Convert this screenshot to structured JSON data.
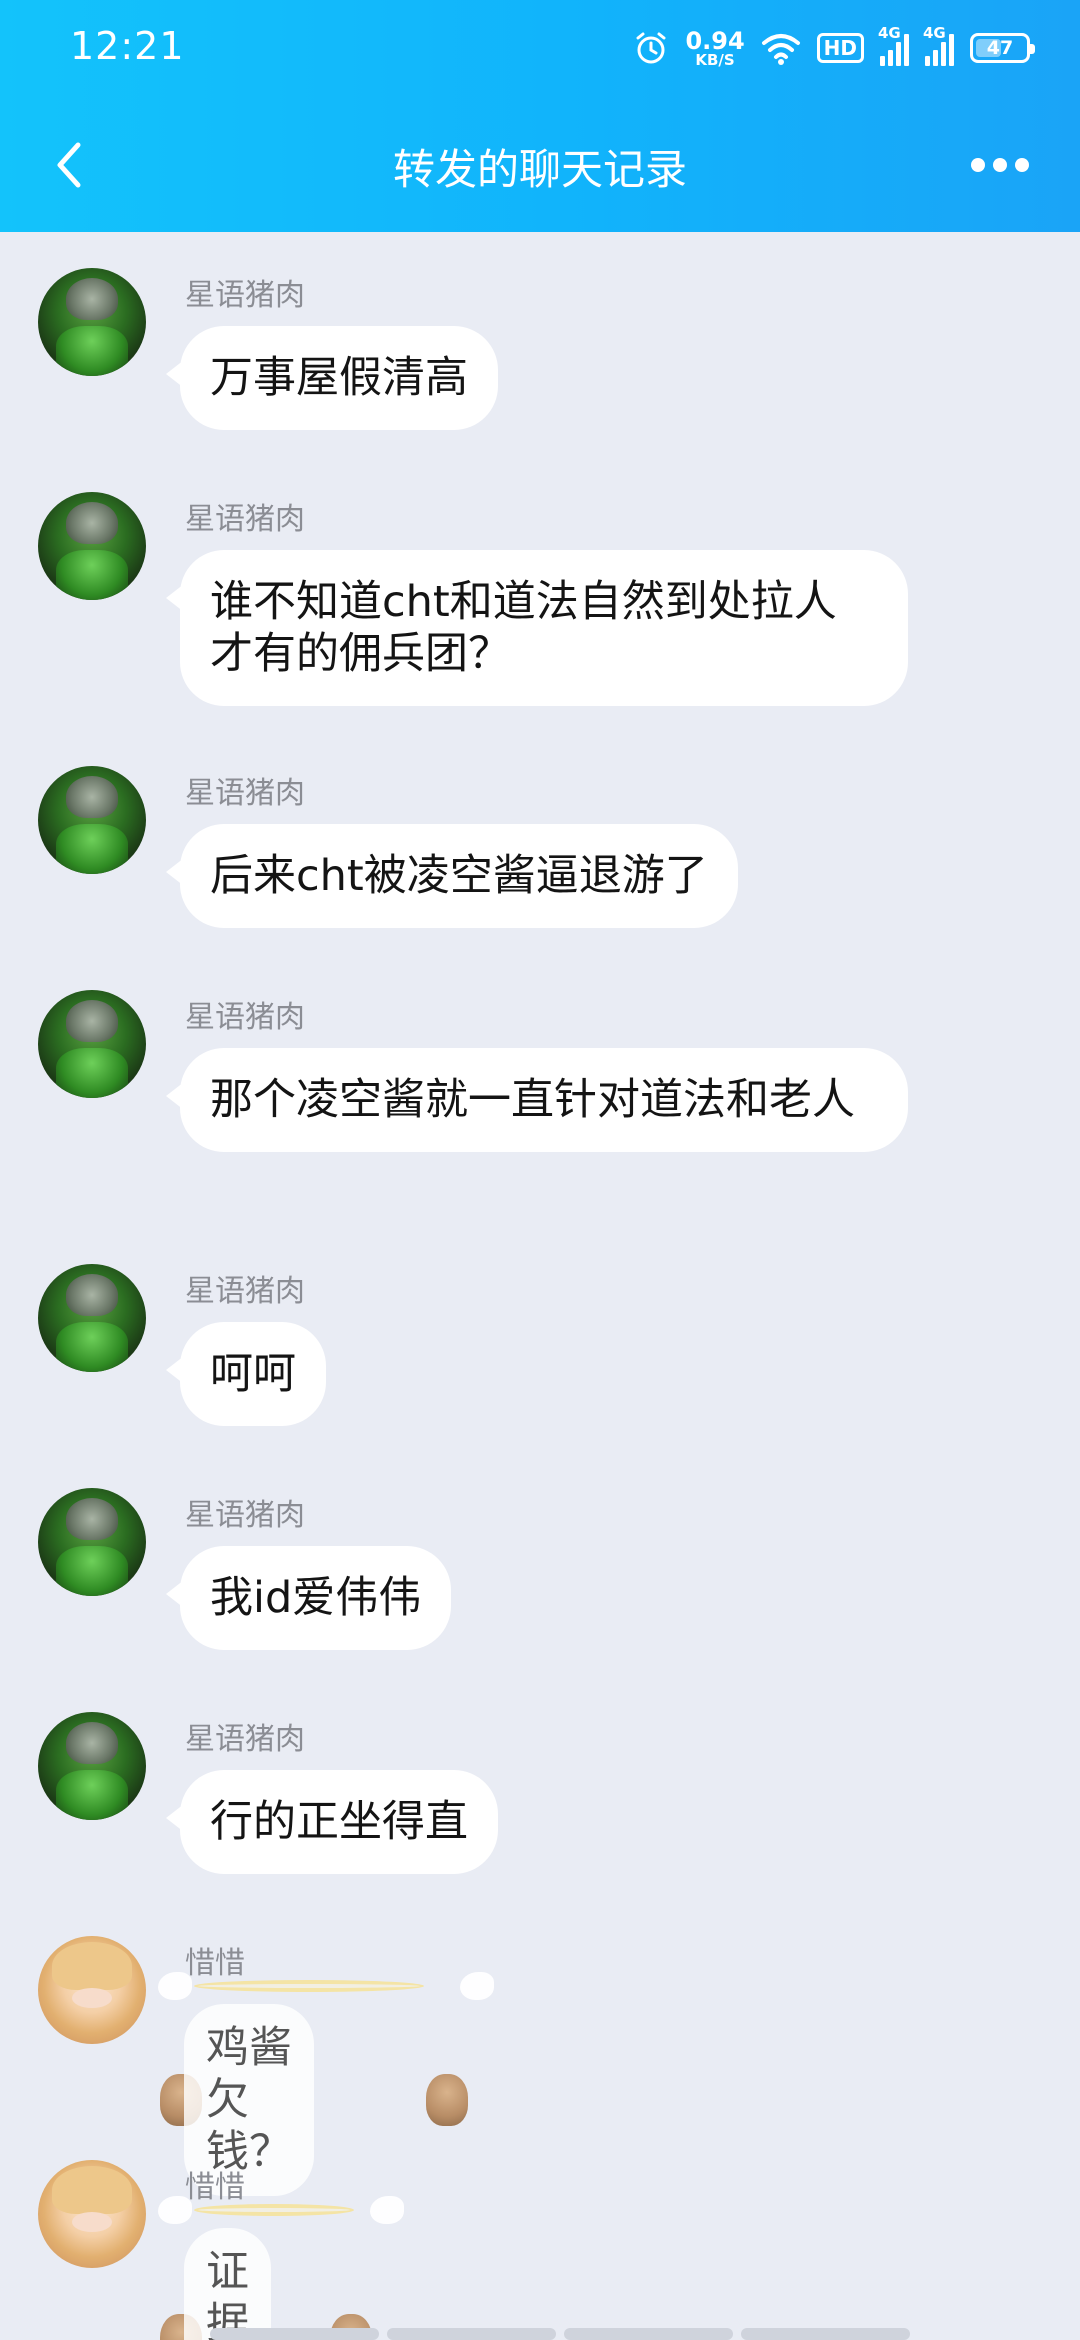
{
  "status_bar": {
    "time": "12:21",
    "net_speed_value": "0.94",
    "net_speed_unit": "KB/S",
    "hd_label": "HD",
    "sim1_label": "4G",
    "sim2_label": "4G",
    "battery_level": "47"
  },
  "navbar": {
    "title": "转发的聊天记录"
  },
  "messages": [
    {
      "sender": "星语猪肉",
      "text": "万事屋假清高"
    },
    {
      "sender": "星语猪肉",
      "text": "谁不知道cht和道法自然到处拉人才有的佣兵团？"
    },
    {
      "sender": "星语猪肉",
      "text": "后来cht被凌空酱逼退游了"
    },
    {
      "sender": "星语猪肉",
      "text": "那个凌空酱就一直针对道法和老人"
    },
    {
      "sender": "星语猪肉",
      "text": "呵呵"
    },
    {
      "sender": "星语猪肉",
      "text": "我id爱伟伟"
    },
    {
      "sender": "星语猪肉",
      "text": "行的正坐得直"
    },
    {
      "sender": "惜惜",
      "text": "鸡酱欠钱？"
    },
    {
      "sender": "惜惜",
      "text": "证据捏"
    }
  ]
}
